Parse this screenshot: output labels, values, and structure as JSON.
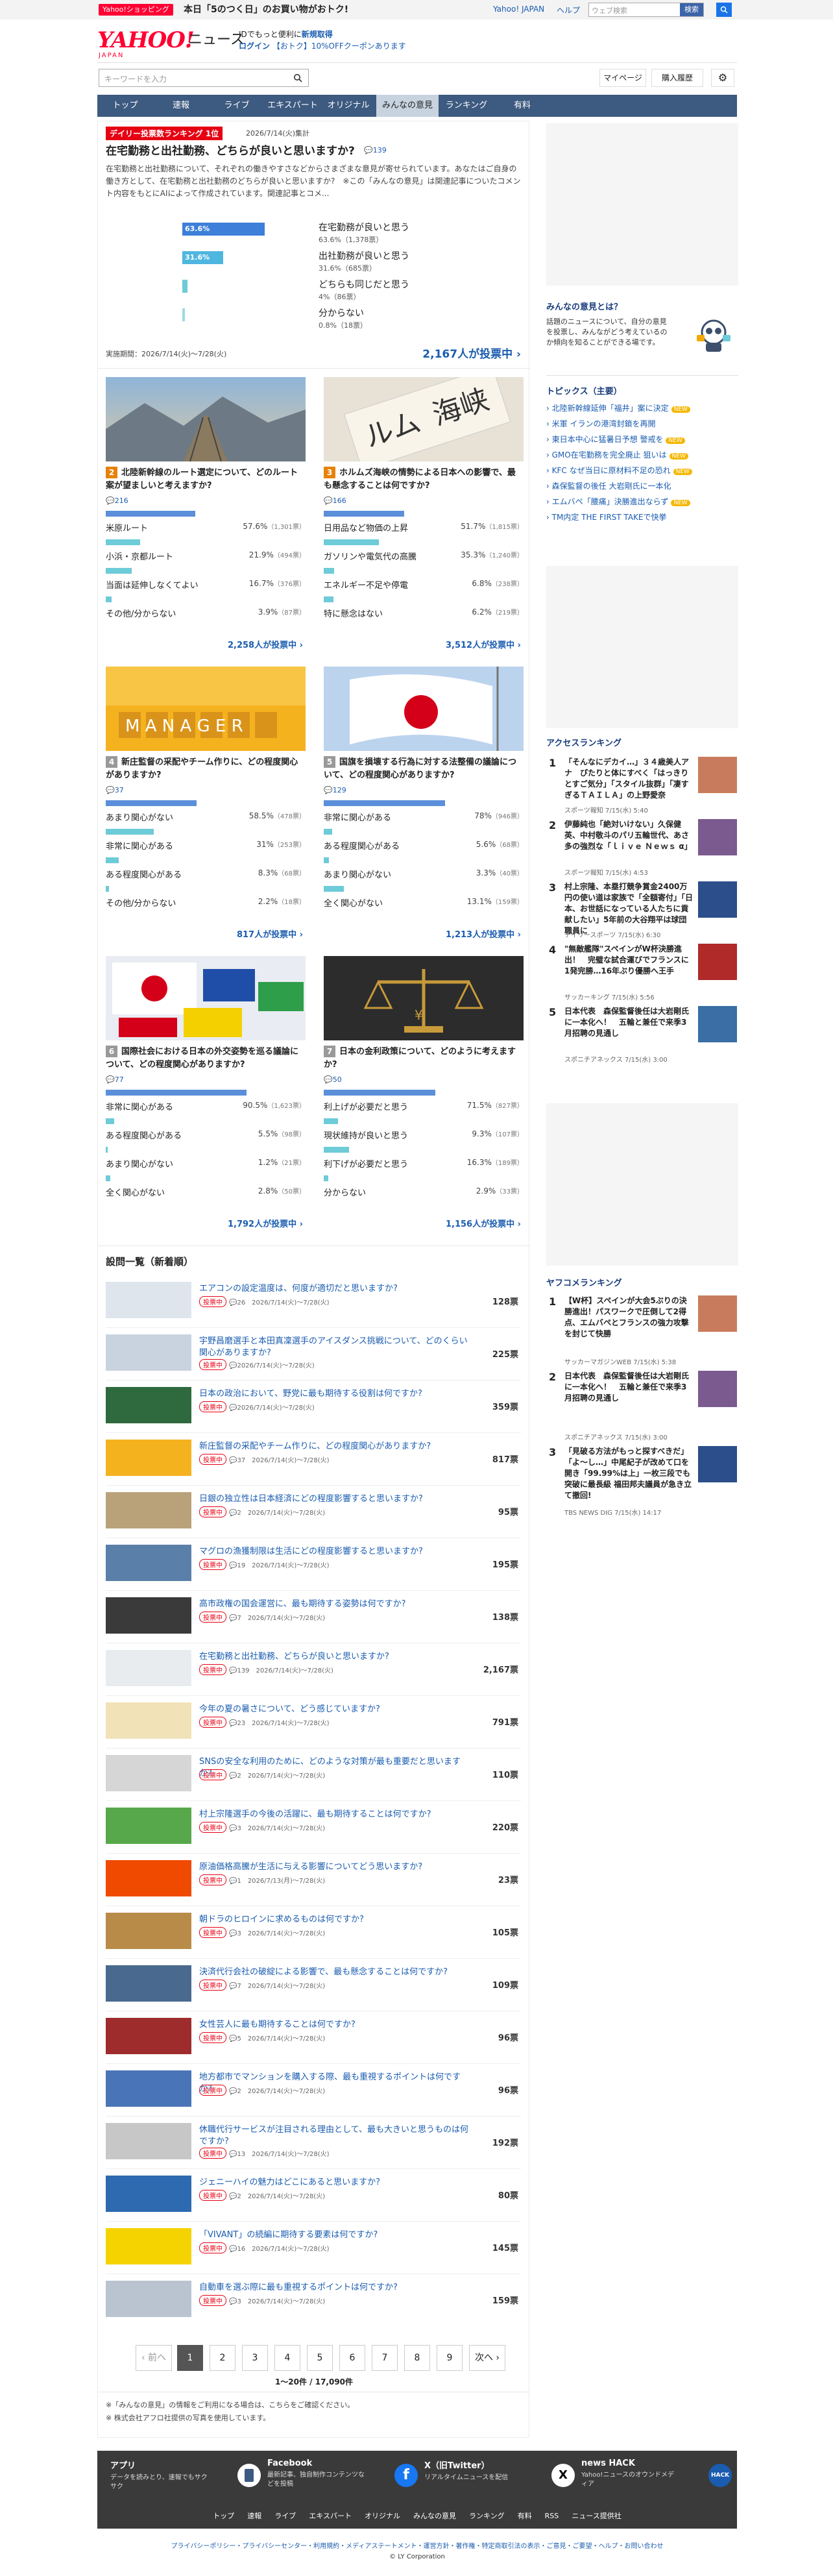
{
  "topbar": {
    "badge": "Yahoo!ショッピング",
    "promo": "本日「5のつく日」のお買い物がおトク!",
    "links": [
      "Yahoo! JAPAN",
      "ヘルプ"
    ],
    "search_placeholder": "ウェブ検索",
    "search_btn": "検索",
    "search_icon": "search-icon"
  },
  "header": {
    "logo": "YAHOO!",
    "logo_sub": "JAPAN",
    "service": "ニュース",
    "login_line1_a": "IDでもっと便利に",
    "login_line1_b": "新規取得",
    "login_line2_a": "ログイン",
    "login_line2_b": "【おトク】10%OFFクーポンあります"
  },
  "searchrow": {
    "placeholder": "キーワードを入力",
    "mypage": "マイページ",
    "history": "購入履歴",
    "settings_icon": "gear-icon"
  },
  "nav": [
    "トップ",
    "速報",
    "ライブ",
    "エキスパート",
    "オリジナル",
    "みんなの意見",
    "ランキング",
    "有料"
  ],
  "lead": {
    "badge": "デイリー投票数ランキング 1位",
    "date": "2026/7/14(火)集計",
    "title": "在宅勤務と出社勤務、どちらが良いと思いますか?",
    "comments": "139",
    "desc": "在宅勤務と出社勤務について、それぞれの働きやすさなどからさまざまな意見が寄せられています。あなたはご自身の働き方として、在宅勤務と出社勤務のどちらが良いと思いますか?　※この「みんなの意見」は関連記事についたコメント内容をもとにAIによって作成されています。関連記事とコメ...",
    "options": [
      {
        "label": "在宅勤務が良いと思う",
        "pct": "63.6%",
        "count": "63.6%（1,378票）",
        "bar_label": "63.6%",
        "value": 63.6
      },
      {
        "label": "出社勤務が良いと思う",
        "pct": "31.6%",
        "count": "31.6%（685票）",
        "bar_label": "31.6%",
        "value": 31.6
      },
      {
        "label": "どちらも同じだと思う",
        "pct": "4%",
        "count": "4%（86票）",
        "bar_label": "",
        "value": 4
      },
      {
        "label": "分からない",
        "pct": "0.8%",
        "count": "0.8%（18票）",
        "bar_label": "",
        "value": 0.8
      }
    ],
    "period": "実施期間：2026/7/14(火)〜7/28(火)",
    "votes": "2,167人が投票中 ›"
  },
  "cards": [
    {
      "num": "2",
      "title": "北陸新幹線のルート選定について、どのルート案が望ましいと考えますか?",
      "comments": "216",
      "options": [
        {
          "label": "米原ルート",
          "val": "57.6%",
          "n": "（1,301票）",
          "value": 57.6
        },
        {
          "label": "小浜・京都ルート",
          "val": "21.9%",
          "n": "（494票）",
          "value": 21.9
        },
        {
          "label": "当面は延伸しなくてよい",
          "val": "16.7%",
          "n": "（376票）",
          "value": 16.7
        },
        {
          "label": "その他/分からない",
          "val": "3.9%",
          "n": "（87票）",
          "value": 3.9
        }
      ],
      "votes": "2,258人が投票中 ›"
    },
    {
      "num": "3",
      "title": "ホルムズ海峡の情勢による日本への影響で、最も懸念することは何ですか?",
      "comments": "166",
      "options": [
        {
          "label": "日用品など物価の上昇",
          "val": "51.7%",
          "n": "（1,815票）",
          "value": 51.7
        },
        {
          "label": "ガソリンや電気代の高騰",
          "val": "35.3%",
          "n": "（1,240票）",
          "value": 35.3
        },
        {
          "label": "エネルギー不足や停電",
          "val": "6.8%",
          "n": "（238票）",
          "value": 6.8
        },
        {
          "label": "特に懸念はない",
          "val": "6.2%",
          "n": "（219票）",
          "value": 6.2
        }
      ],
      "votes": "3,512人が投票中 ›"
    },
    {
      "num": "4",
      "title": "新庄監督の采配やチーム作りに、どの程度関心がありますか?",
      "comments": "37",
      "options": [
        {
          "label": "あまり関心がない",
          "val": "58.5%",
          "n": "（478票）",
          "value": 58.5
        },
        {
          "label": "非常に関心がある",
          "val": "31%",
          "n": "（253票）",
          "value": 31
        },
        {
          "label": "ある程度関心がある",
          "val": "8.3%",
          "n": "（68票）",
          "value": 8.3
        },
        {
          "label": "その他/分からない",
          "val": "2.2%",
          "n": "（18票）",
          "value": 2.2
        }
      ],
      "votes": "817人が投票中 ›"
    },
    {
      "num": "5",
      "title": "国旗を損壊する行為に対する法整備の議論について、どの程度関心がありますか?",
      "comments": "129",
      "options": [
        {
          "label": "非常に関心がある",
          "val": "78%",
          "n": "（946票）",
          "value": 78
        },
        {
          "label": "ある程度関心がある",
          "val": "5.6%",
          "n": "（68票）",
          "value": 5.6
        },
        {
          "label": "あまり関心がない",
          "val": "3.3%",
          "n": "（40票）",
          "value": 3.3
        },
        {
          "label": "全く関心がない",
          "val": "13.1%",
          "n": "（159票）",
          "value": 13.1
        }
      ],
      "votes": "1,213人が投票中 ›"
    },
    {
      "num": "6",
      "title": "国際社会における日本の外交姿勢を巡る議論について、どの程度関心がありますか?",
      "comments": "77",
      "options": [
        {
          "label": "非常に関心がある",
          "val": "90.5%",
          "n": "（1,623票）",
          "value": 90.5
        },
        {
          "label": "ある程度関心がある",
          "val": "5.5%",
          "n": "（98票）",
          "value": 5.5
        },
        {
          "label": "あまり関心がない",
          "val": "1.2%",
          "n": "（21票）",
          "value": 1.2
        },
        {
          "label": "全く関心がない",
          "val": "2.8%",
          "n": "（50票）",
          "value": 2.8
        }
      ],
      "votes": "1,792人が投票中 ›"
    },
    {
      "num": "7",
      "title": "日本の金利政策について、どのように考えますか?",
      "comments": "50",
      "options": [
        {
          "label": "利上げが必要だと思う",
          "val": "71.5%",
          "n": "（827票）",
          "value": 71.5
        },
        {
          "label": "現状維持が良いと思う",
          "val": "9.3%",
          "n": "（107票）",
          "value": 9.3
        },
        {
          "label": "利下げが必要だと思う",
          "val": "16.3%",
          "n": "（189票）",
          "value": 16.3
        },
        {
          "label": "分からない",
          "val": "2.9%",
          "n": "（33票）",
          "value": 2.9
        }
      ],
      "votes": "1,156人が投票中 ›"
    }
  ],
  "list": {
    "heading": "設問一覧（新着順）",
    "tag": "投票中",
    "items": [
      {
        "title": "エアコンの設定温度は、何度が適切だと思いますか?",
        "meta": "26　2026/7/14(火)〜7/28(火)",
        "votes": "128票"
      },
      {
        "title": "宇野昌磨選手と本田真凜選手のアイスダンス挑戦について、どのくらい関心がありますか?",
        "meta": "2026/7/14(火)〜7/28(火)",
        "votes": "225票"
      },
      {
        "title": "日本の政治において、野党に最も期待する役割は何ですか?",
        "meta": "2026/7/14(火)〜7/28(火)",
        "votes": "359票"
      },
      {
        "title": "新庄監督の采配やチーム作りに、どの程度関心がありますか?",
        "meta": "37　2026/7/14(火)〜7/28(火)",
        "votes": "817票"
      },
      {
        "title": "日銀の独立性は日本経済にどの程度影響すると思いますか?",
        "meta": "2　2026/7/14(火)〜7/28(火)",
        "votes": "95票"
      },
      {
        "title": "マグロの漁獲制限は生活にどの程度影響すると思いますか?",
        "meta": "19　2026/7/14(火)〜7/28(火)",
        "votes": "195票"
      },
      {
        "title": "高市政権の国会運営に、最も期待する姿勢は何ですか?",
        "meta": "7　2026/7/14(火)〜7/28(火)",
        "votes": "138票"
      },
      {
        "title": "在宅勤務と出社勤務、どちらが良いと思いますか?",
        "meta": "139　2026/7/14(火)〜7/28(火)",
        "votes": "2,167票"
      },
      {
        "title": "今年の夏の暑さについて、どう感じていますか?",
        "meta": "23　2026/7/14(火)〜7/28(火)",
        "votes": "791票"
      },
      {
        "title": "SNSの安全な利用のために、どのような対策が最も重要だと思いますか?",
        "meta": "2　2026/7/14(火)〜7/28(火)",
        "votes": "110票"
      },
      {
        "title": "村上宗隆選手の今後の活躍に、最も期待することは何ですか?",
        "meta": "3　2026/7/14(火)〜7/28(火)",
        "votes": "220票"
      },
      {
        "title": "原油価格高騰が生活に与える影響についてどう思いますか?",
        "meta": "1　2026/7/13(月)〜7/28(火)",
        "votes": "23票"
      },
      {
        "title": "朝ドラのヒロインに求めるものは何ですか?",
        "meta": "3　2026/7/14(火)〜7/28(火)",
        "votes": "105票"
      },
      {
        "title": "決済代行会社の破綻による影響で、最も懸念することは何ですか?",
        "meta": "7　2026/7/14(火)〜7/28(火)",
        "votes": "109票"
      },
      {
        "title": "女性芸人に最も期待することは何ですか?",
        "meta": "5　2026/7/14(火)〜7/28(火)",
        "votes": "96票"
      },
      {
        "title": "地方都市でマンションを購入する際、最も重視するポイントは何ですか?",
        "meta": "2　2026/7/14(火)〜7/28(火)",
        "votes": "96票"
      },
      {
        "title": "休職代行サービスが注目される理由として、最も大きいと思うものは何ですか?",
        "meta": "13　2026/7/14(火)〜7/28(火)",
        "votes": "192票"
      },
      {
        "title": "ジェニーハイの魅力はどこにあると思いますか?",
        "meta": "2　2026/7/14(火)〜7/28(火)",
        "votes": "80票"
      },
      {
        "title": "「VIVANT」の続編に期待する要素は何ですか?",
        "meta": "16　2026/7/14(火)〜7/28(火)",
        "votes": "145票"
      },
      {
        "title": "自動車を選ぶ際に最も重視するポイントは何ですか?",
        "meta": "3　2026/7/14(火)〜7/28(火)",
        "votes": "159票"
      }
    ]
  },
  "pager": {
    "prev": "‹ 前へ",
    "pages": [
      "1",
      "2",
      "3",
      "4",
      "5",
      "6",
      "7",
      "8",
      "9"
    ],
    "next": "次へ ›",
    "summary": "1〜20件 / 17,090件"
  },
  "notes": [
    "※「みんなの意見」の情報をご利用になる場合は、こちらをご確認ください。",
    "※ 株式会社アフロ社提供の写真を使用しています。"
  ],
  "sidebar": {
    "about_title": "みんなの意見とは？",
    "about_text": "話題のニュースについて、自分の意見を投票し、みんながどう考えているのか傾向を知ることができる場です。",
    "topics_title": "トピックス（主要）",
    "topics": [
      {
        "t": "北陸新幹線延伸「福井」案に決定",
        "badge": "NEW"
      },
      {
        "t": "米軍 イランの港湾封鎖を再開",
        "badge": ""
      },
      {
        "t": "東日本中心に猛暑日予想 警戒を",
        "badge": "NEW"
      },
      {
        "t": "GMO在宅勤務を完全廃止 狙いは",
        "badge": "NEW"
      },
      {
        "t": "KFC なぜ当日に原材料不足の恐れ",
        "badge": "NEW"
      },
      {
        "t": "森保監督の後任 大岩剛氏に一本化",
        "badge": ""
      },
      {
        "t": "エムバペ「腰痛」決勝進出ならず",
        "badge": "NEW"
      },
      {
        "t": "TM内定 THE FIRST TAKEで快挙",
        "badge": ""
      }
    ],
    "access_title": "アクセスランキング",
    "access": [
      {
        "num": "1",
        "title": "「そんなにデカイ…」３４歳美人アナ　ぴたりと体にすべく「はっきりとすご気分」「スタイル抜群」「凄すぎるＴＡＩＬＡ」の上野愛奈",
        "meta": "スポーツ報知 7/15(水) 5:40"
      },
      {
        "num": "2",
        "title": "伊藤純也「絶対いけない」久保健英、中村敬斗のパリ五輪世代、あさ多の強烈な「ｌｉｖｅ Ｎｅｗｓ α」",
        "meta": "スポーツ報知 7/15(水) 4:53"
      },
      {
        "num": "3",
        "title": "村上宗隆、本塁打競争賞金2400万円の使い道は家族で「全額寄付」「日本、お世話になっている人たちに貢献したい」5年前の大谷翔平は球団職員に",
        "meta": "デイリースポーツ 7/15(水) 6:30"
      },
      {
        "num": "4",
        "title": "\"無敵艦隊\"スペインがW杯決勝進出！　完璧な試合運びでフランスに1発完勝…16年ぶり優勝へ王手",
        "meta": "サッカーキング 7/15(水) 5:56"
      },
      {
        "num": "5",
        "title": "日本代表　森保監督後任は大岩剛氏に一本化へ！　五輪と兼任で来季3月招聘の見通し",
        "meta": "スポニチアネックス 7/15(水) 3:00"
      }
    ],
    "yafuko_title": "ヤフコメランキング",
    "yafuko": [
      {
        "num": "1",
        "title": "【W杯】スペインが大会5ぶりの決勝進出！パスワークで圧倒して2得点、エムバペとフランスの強力攻撃を封じて快勝",
        "meta": "サッカーマガジンWEB 7/15(水) 5:38"
      },
      {
        "num": "2",
        "title": "日本代表　森保監督後任は大岩剛氏に一本化へ！　五輪と兼任で来季3月招聘の見通し",
        "meta": "スポニチアネックス 7/15(水) 3:00"
      },
      {
        "num": "3",
        "title": "「見破る方法がもっと探すべきだ」「よ〜し…」中尾紀子が改めて口を開き「99.99%は上」一枚三段でも突破に最長級 福田邦夫議員が急き立て撤回!",
        "meta": "TBS NEWS DIG 7/15(水) 14:17"
      }
    ]
  },
  "footer": {
    "cols": [
      {
        "title": "アプリ",
        "desc": "データを読みとり、速報でもサクサク"
      },
      {
        "title": "Facebook",
        "desc": "最新記事、独自制作コンテンツなどを投稿"
      },
      {
        "title": "X（旧Twitter）",
        "desc": "リアルタイムニュースを配信"
      },
      {
        "title": "news HACK",
        "desc": "Yahoo!ニュースのオウンドメディア"
      }
    ],
    "nav": [
      "トップ",
      "速報",
      "ライブ",
      "エキスパート",
      "オリジナル",
      "みんなの意見",
      "ランキング",
      "有料",
      "RSS",
      "ニュース提供社"
    ],
    "links": "プライバシーポリシー・プライバシーセンター・利用規約・メディアステートメント・運営方針・著作権・特定商取引法の表示・ご意見・ご要望・ヘルプ・お問い合わせ",
    "copyright": "© LY Corporation"
  },
  "colors": {
    "accent": "#1a5cb0",
    "brand": "#ff0033",
    "nav": "#3d5a80",
    "bar": "#5b8fd9",
    "bar_teal": "#6ecbd8"
  }
}
